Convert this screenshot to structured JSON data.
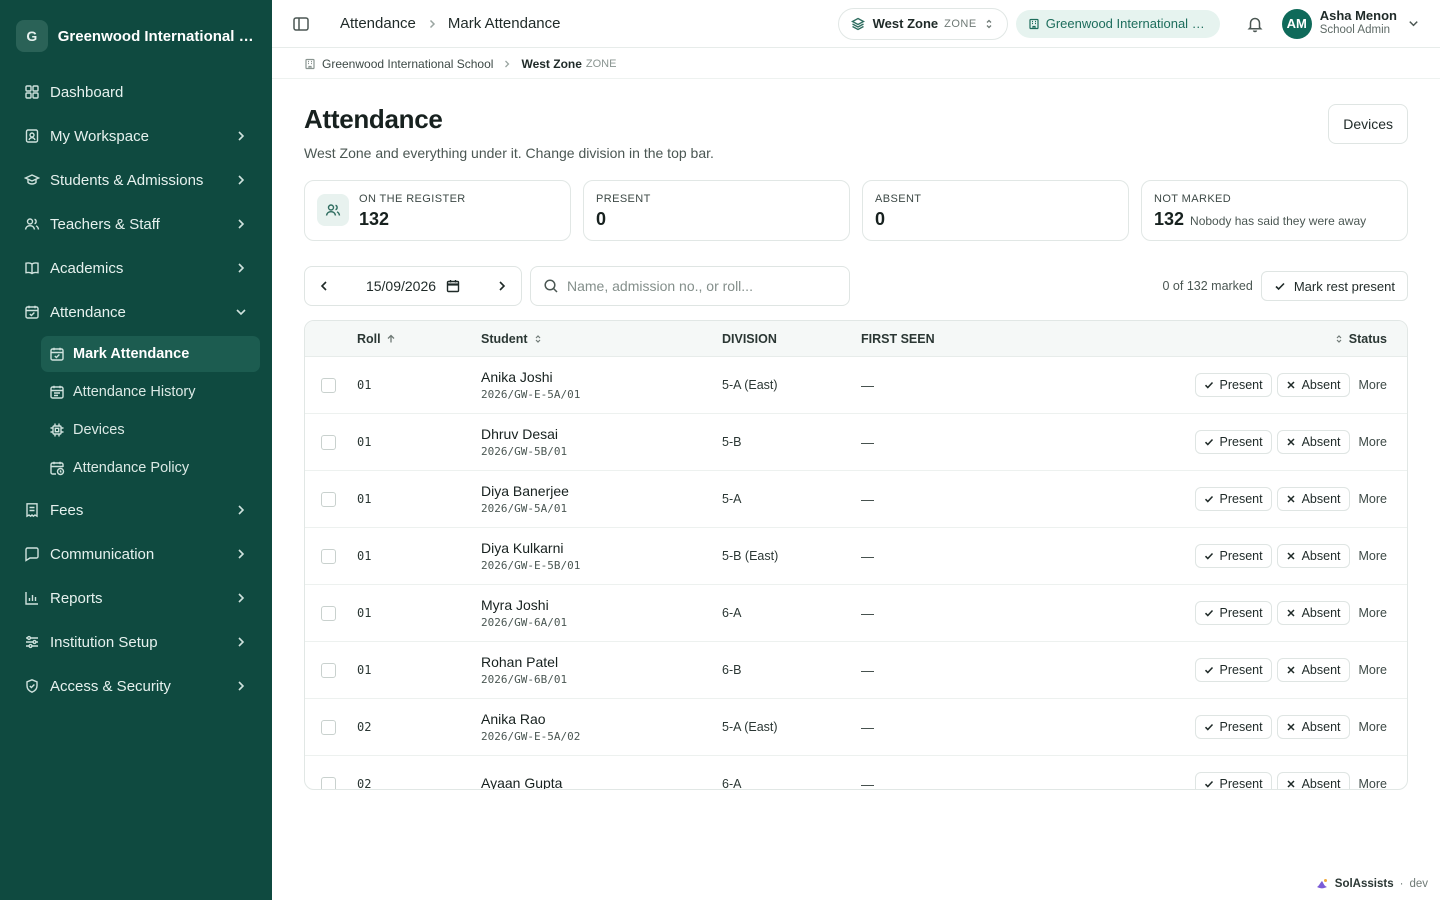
{
  "brand": {
    "initial": "G",
    "name": "Greenwood International School"
  },
  "sidebar": {
    "items": [
      {
        "label": "Dashboard",
        "icon": "dashboard-icon"
      },
      {
        "label": "My Workspace",
        "icon": "workspace-icon"
      },
      {
        "label": "Students & Admissions",
        "icon": "graduation-cap-icon"
      },
      {
        "label": "Teachers & Staff",
        "icon": "users-icon"
      },
      {
        "label": "Academics",
        "icon": "book-icon"
      },
      {
        "label": "Attendance",
        "icon": "calendar-check-icon",
        "expanded": true
      },
      {
        "label": "Fees",
        "icon": "receipt-icon"
      },
      {
        "label": "Communication",
        "icon": "message-icon"
      },
      {
        "label": "Reports",
        "icon": "bar-chart-icon"
      },
      {
        "label": "Institution Setup",
        "icon": "sliders-icon"
      },
      {
        "label": "Access & Security",
        "icon": "shield-icon"
      }
    ],
    "attendance_sub": [
      {
        "label": "Mark Attendance",
        "active": true
      },
      {
        "label": "Attendance History"
      },
      {
        "label": "Devices"
      },
      {
        "label": "Attendance Policy"
      }
    ]
  },
  "topbar": {
    "crumb1": "Attendance",
    "crumb2": "Mark Attendance",
    "zone_name": "West Zone",
    "zone_tag": "ZONE",
    "school": "Greenwood International School",
    "user_initials": "AM",
    "user_name": "Asha Menon",
    "user_role": "School Admin"
  },
  "subcrumb": {
    "school": "Greenwood International School",
    "zone": "West Zone",
    "zone_tag": "ZONE"
  },
  "page": {
    "title": "Attendance",
    "subtitle": "West Zone and everything under it. Change division in the top bar.",
    "devices_button": "Devices"
  },
  "stats": {
    "register_label": "ON THE REGISTER",
    "register_value": "132",
    "present_label": "PRESENT",
    "present_value": "0",
    "absent_label": "ABSENT",
    "absent_value": "0",
    "notmarked_label": "NOT MARKED",
    "notmarked_value": "132",
    "notmarked_note": "Nobody has said they were away"
  },
  "toolbar": {
    "date": "15/09/2026",
    "search_placeholder": "Name, admission no., or roll...",
    "marked_text": "0 of 132 marked",
    "mark_rest_label": "Mark rest present"
  },
  "table": {
    "headers": {
      "roll": "Roll",
      "student": "Student",
      "division": "DIVISION",
      "first_seen": "FIRST SEEN",
      "status": "Status"
    },
    "action_present": "Present",
    "action_absent": "Absent",
    "action_more": "More",
    "rows": [
      {
        "roll": "01",
        "name": "Anika Joshi",
        "adm": "2026/GW-E-5A/01",
        "division": "5-A (East)",
        "first_seen": "—"
      },
      {
        "roll": "01",
        "name": "Dhruv Desai",
        "adm": "2026/GW-5B/01",
        "division": "5-B",
        "first_seen": "—"
      },
      {
        "roll": "01",
        "name": "Diya Banerjee",
        "adm": "2026/GW-5A/01",
        "division": "5-A",
        "first_seen": "—"
      },
      {
        "roll": "01",
        "name": "Diya Kulkarni",
        "adm": "2026/GW-E-5B/01",
        "division": "5-B (East)",
        "first_seen": "—"
      },
      {
        "roll": "01",
        "name": "Myra Joshi",
        "adm": "2026/GW-6A/01",
        "division": "6-A",
        "first_seen": "—"
      },
      {
        "roll": "01",
        "name": "Rohan Patel",
        "adm": "2026/GW-6B/01",
        "division": "6-B",
        "first_seen": "—"
      },
      {
        "roll": "02",
        "name": "Anika Rao",
        "adm": "2026/GW-E-5A/02",
        "division": "5-A (East)",
        "first_seen": "—"
      },
      {
        "roll": "02",
        "name": "Ayaan Gupta",
        "adm": "",
        "division": "6-A",
        "first_seen": "—"
      }
    ]
  },
  "footer": {
    "brand": "SolAssists",
    "env": "dev"
  }
}
